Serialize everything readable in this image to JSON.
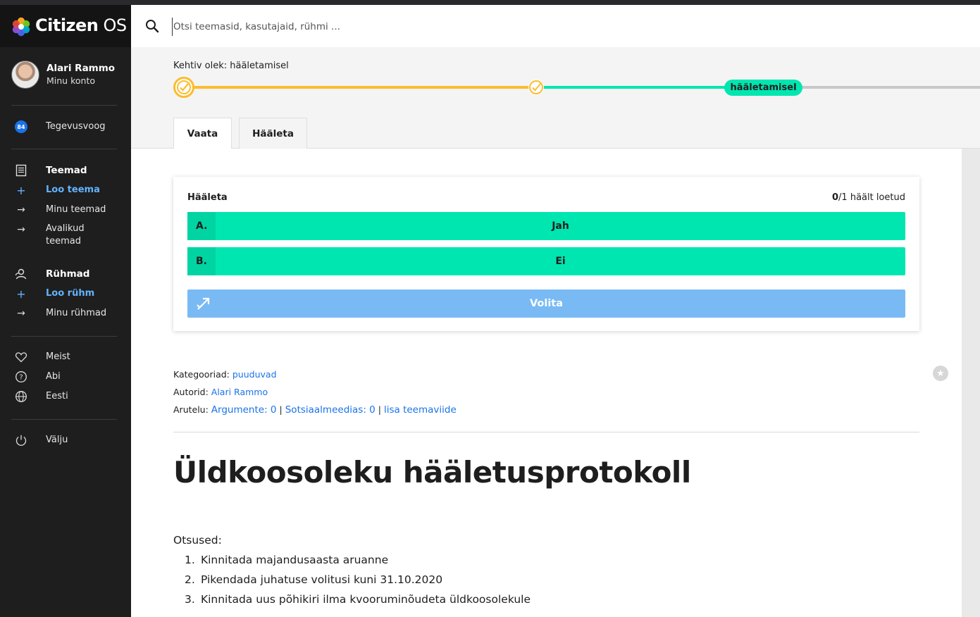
{
  "app": {
    "logo_bold": "Citizen",
    "logo_light": "OS"
  },
  "user": {
    "name": "Alari Rammo",
    "account_label": "Minu konto"
  },
  "sidebar": {
    "activity": {
      "badge": "84",
      "label": "Tegevusvoog"
    },
    "topics": {
      "heading": "Teemad",
      "create": "Loo teema",
      "mine": "Minu teemad",
      "public": "Avalikud teemad"
    },
    "groups": {
      "heading": "Rühmad",
      "create": "Loo rühm",
      "mine": "Minu rühmad"
    },
    "about": "Meist",
    "help": "Abi",
    "language": "Eesti",
    "logout": "Välju"
  },
  "search": {
    "placeholder": "Otsi teemasid, kasutajaid, rühmi ..."
  },
  "status": {
    "label": "Kehtiv olek: hääletamisel",
    "current_phase": "hääletamisel",
    "colors": {
      "done": "#fbbd2e",
      "active": "#00e6b0",
      "pending": "#c8c8c8"
    }
  },
  "tabs": [
    {
      "label": "Vaata"
    },
    {
      "label": "Hääleta"
    }
  ],
  "vote": {
    "title": "Hääleta",
    "count_current": "0",
    "count_rest": "/1 häält loetud",
    "options": [
      {
        "letter": "A.",
        "text": "Jah"
      },
      {
        "letter": "B.",
        "text": "Ei"
      }
    ],
    "delegate_label": "Volita",
    "colors": {
      "option": "#00e6b0",
      "delegate": "#79baf5"
    }
  },
  "meta": {
    "categories_label": "Kategooriad:",
    "categories_value": "puuduvad",
    "authors_label": "Autorid:",
    "authors_value": "Alari Rammo",
    "discussion_label": "Arutelu:",
    "arguments": "Argumente: 0",
    "social": "Sotsiaalmeedias: 0",
    "add_link": "lisa teemaviide"
  },
  "topic": {
    "title": "Üldkoosoleku hääletusprotokoll",
    "decisions_label": "Otsused:",
    "decisions": [
      {
        "num": "1.",
        "text": "Kinnitada majandusaasta aruanne"
      },
      {
        "num": "2.",
        "text": "Pikendada juhatuse volitusi kuni 31.10.2020"
      },
      {
        "num": "3.",
        "text": "Kinnitada uus põhikiri ilma kvooruminõudeta üldkoosolekule"
      }
    ]
  }
}
